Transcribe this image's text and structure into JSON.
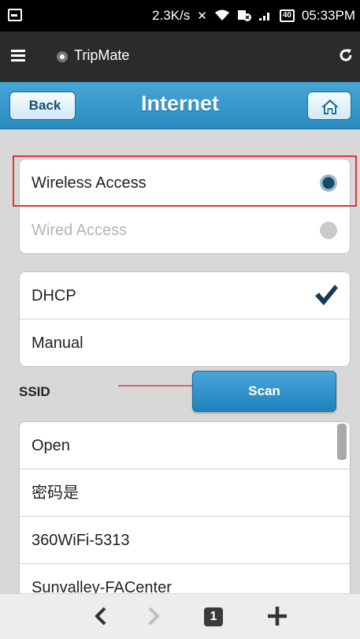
{
  "status_bar": {
    "speed": "2.3K/s",
    "battery": "40",
    "time": "05:33PM",
    "icons": [
      "screenshot-icon",
      "mute-icon",
      "wifi-icon",
      "data-off-icon",
      "signal-icon",
      "battery-icon"
    ]
  },
  "browser": {
    "title": "TripMate"
  },
  "header": {
    "back_label": "Back",
    "title": "Internet"
  },
  "access": {
    "items": [
      {
        "label": "Wireless Access",
        "selected": true
      },
      {
        "label": "Wired Access",
        "selected": false
      }
    ]
  },
  "ip_mode": {
    "items": [
      {
        "label": "DHCP",
        "checked": true
      },
      {
        "label": "Manual",
        "checked": false
      }
    ]
  },
  "ssid": {
    "label": "SSID",
    "scan_label": "Scan",
    "networks": [
      "Open",
      "密码是",
      "360WiFi-5313",
      "Sunvalley-FACenter"
    ]
  },
  "bottom_nav": {
    "tab_count": "1"
  },
  "colors": {
    "accent": "#2a8cc0",
    "highlight": "#e2343d"
  }
}
